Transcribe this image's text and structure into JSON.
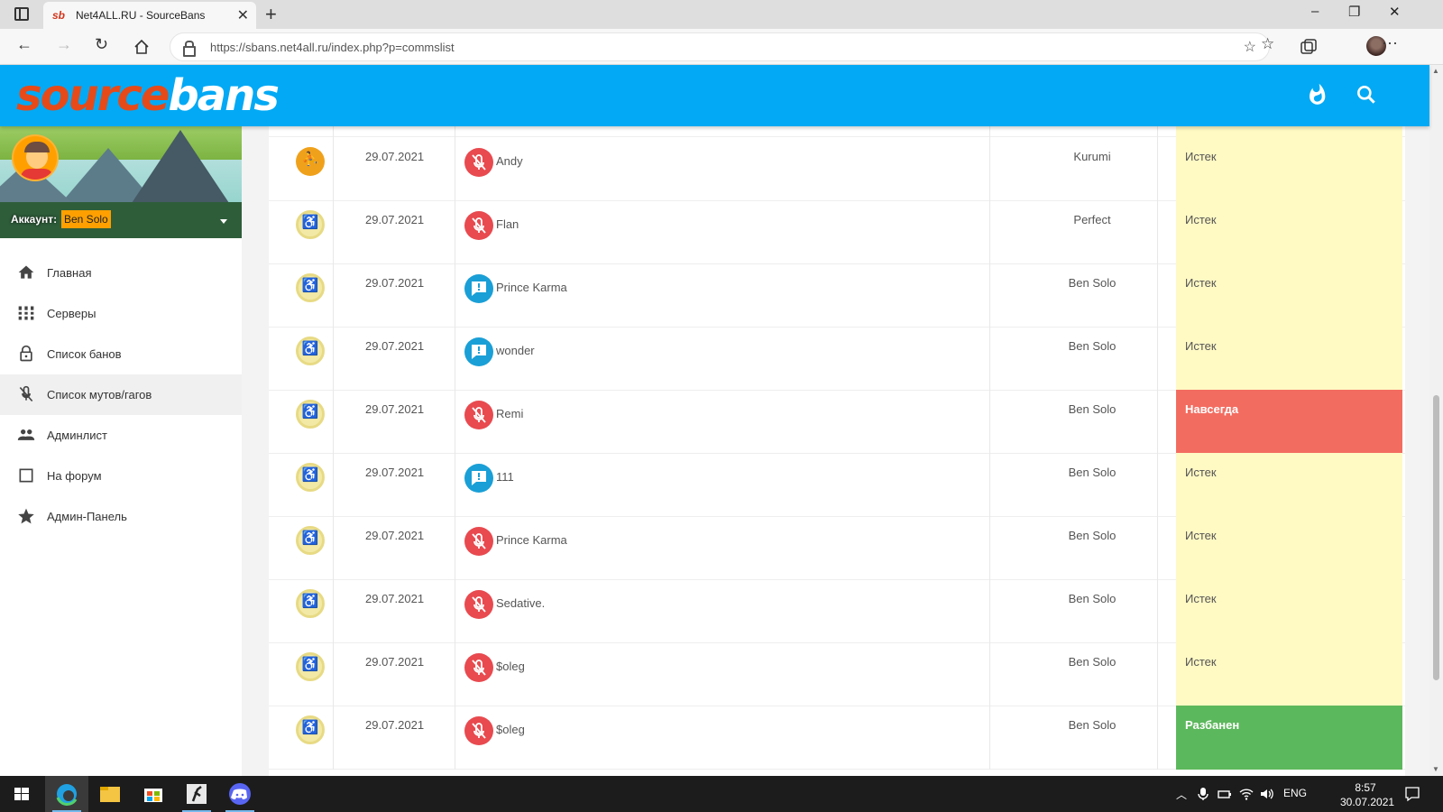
{
  "browser": {
    "tab_title": "Net4ALL.RU - SourceBans",
    "favicon_text": "sb",
    "url": "https://sbans.net4all.ru/index.php?p=commslist",
    "window_controls": [
      "–",
      "❐",
      "✕"
    ]
  },
  "header": {
    "logo_part1": "source",
    "logo_part2": "bans",
    "icons": [
      "fire-icon",
      "search-icon"
    ],
    "color": "#03a9f4"
  },
  "sidebar": {
    "account_label": "Аккаунт:",
    "account_name": "Ben Solo",
    "items": [
      {
        "label": "Главная",
        "icon": "home-icon"
      },
      {
        "label": "Серверы",
        "icon": "servers-icon"
      },
      {
        "label": "Список банов",
        "icon": "lock-icon"
      },
      {
        "label": "Список мутов/гагов",
        "icon": "mic-off-icon",
        "active": true
      },
      {
        "label": "Админлист",
        "icon": "people-icon"
      },
      {
        "label": "На форум",
        "icon": "square-icon"
      },
      {
        "label": "Админ-Панель",
        "icon": "star-icon"
      }
    ]
  },
  "comms": {
    "rows": [
      {
        "game": "active",
        "date": "29.07.2021",
        "type": "mute",
        "player": "Andy",
        "admin": "Kurumi",
        "status": "Истек",
        "status_type": "expired"
      },
      {
        "game": "inactive",
        "date": "29.07.2021",
        "type": "mute",
        "player": "Flan",
        "admin": "Perfect",
        "status": "Истек",
        "status_type": "expired"
      },
      {
        "game": "inactive",
        "date": "29.07.2021",
        "type": "gag",
        "player": "Prince Karma",
        "admin": "Ben Solo",
        "status": "Истек",
        "status_type": "expired"
      },
      {
        "game": "inactive",
        "date": "29.07.2021",
        "type": "gag",
        "player": "wonder",
        "admin": "Ben Solo",
        "status": "Истек",
        "status_type": "expired"
      },
      {
        "game": "inactive",
        "date": "29.07.2021",
        "type": "mute",
        "player": "Remi",
        "admin": "Ben Solo",
        "status": "Навсегда",
        "status_type": "forever"
      },
      {
        "game": "inactive",
        "date": "29.07.2021",
        "type": "gag",
        "player": "111",
        "admin": "Ben Solo",
        "status": "Истек",
        "status_type": "expired"
      },
      {
        "game": "inactive",
        "date": "29.07.2021",
        "type": "mute",
        "player": "Prince Karma",
        "admin": "Ben Solo",
        "status": "Истек",
        "status_type": "expired"
      },
      {
        "game": "inactive",
        "date": "29.07.2021",
        "type": "mute",
        "player": "Sedative.",
        "admin": "Ben Solo",
        "status": "Истек",
        "status_type": "expired"
      },
      {
        "game": "inactive",
        "date": "29.07.2021",
        "type": "mute",
        "player": "$oleg",
        "admin": "Ben Solo",
        "status": "Истек",
        "status_type": "expired"
      },
      {
        "game": "inactive",
        "date": "29.07.2021",
        "type": "mute",
        "player": "$oleg",
        "admin": "Ben Solo",
        "status": "Разбанен",
        "status_type": "unbanned"
      }
    ],
    "status_colors": {
      "expired": "#fff9c4",
      "forever": "#f36c60",
      "unbanned": "#5cb85c"
    }
  },
  "taskbar": {
    "apps": [
      "start-icon",
      "edge-icon",
      "explorer-icon",
      "store-icon",
      "counter-strike-icon",
      "discord-icon"
    ],
    "language": "ENG",
    "time": "8:57",
    "date": "30.07.2021"
  }
}
